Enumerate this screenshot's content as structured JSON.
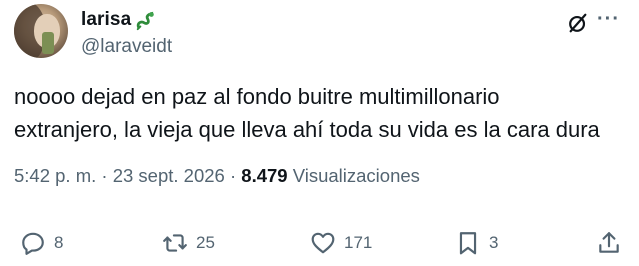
{
  "author": {
    "display_name": "larisa",
    "handle": "@laraveidt",
    "name_emoji": "dragon-icon"
  },
  "tweet": {
    "text_line1": "noooo dejad en paz al fondo buitre multimillonario",
    "text_line2": "extranjero, la vieja que lleva ahí toda su vida es la cara dura"
  },
  "meta": {
    "time": "5:42 p. m.",
    "separator": "·",
    "date": "23 sept. 2026",
    "views_count": "8.479",
    "views_label": "Visualizaciones"
  },
  "actions": {
    "replies": "8",
    "retweets": "25",
    "likes": "171",
    "bookmarks": "3"
  },
  "header_icons": [
    "grok-icon",
    "more-icon"
  ],
  "colors": {
    "text": "#0f1419",
    "secondary": "#536471",
    "dragon": "#2e8b3a"
  }
}
